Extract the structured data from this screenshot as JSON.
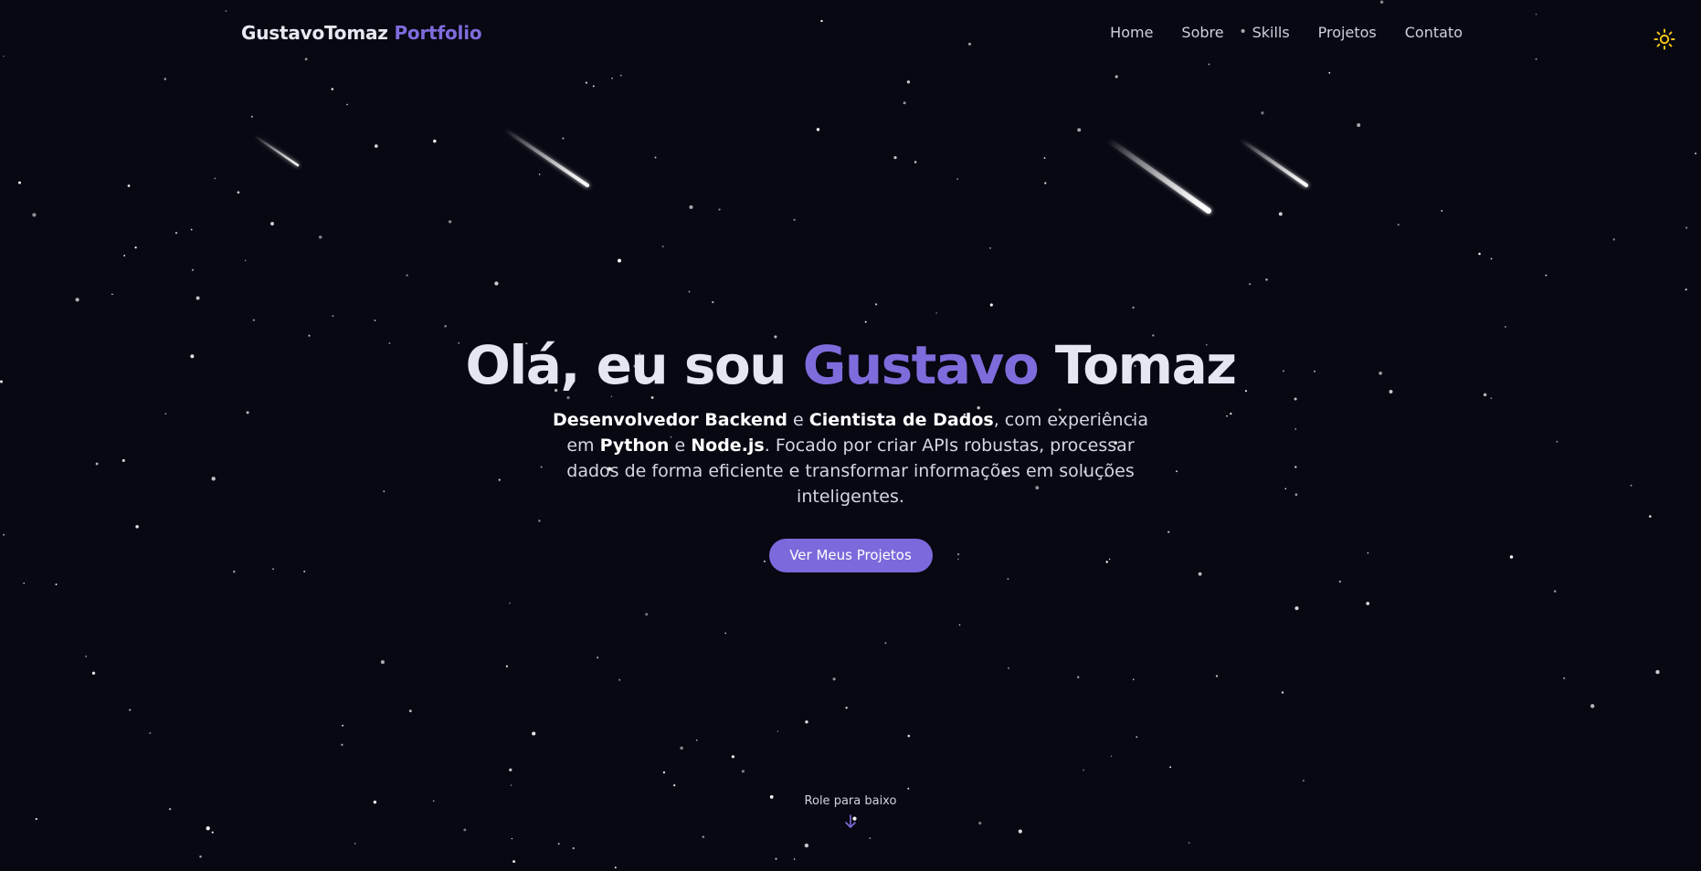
{
  "brand": {
    "name": "GustavoTomaz",
    "suffix": "Portfolio"
  },
  "nav": {
    "items": [
      {
        "label": "Home"
      },
      {
        "label": "Sobre"
      },
      {
        "label": "Skills"
      },
      {
        "label": "Projetos"
      },
      {
        "label": "Contato"
      }
    ]
  },
  "theme_toggle": {
    "icon": "sun-icon",
    "color": "#f5c518"
  },
  "hero": {
    "greeting": "Olá, eu sou",
    "first_name": "Gustavo",
    "last_name": "Tomaz",
    "description": {
      "role1": "Desenvolvedor Backend",
      "connector1": " e ",
      "role2": "Cientista de Dados",
      "text1": ", com experiência em ",
      "tech1": "Python",
      "connector2": " e ",
      "tech2": "Node.js",
      "text2": ". Focado por criar APIs robustas, processar dados de forma eficiente e transformar informações em soluções inteligentes."
    },
    "cta_label": "Ver Meus Projetos"
  },
  "scroll_hint": {
    "label": "Role para baixo",
    "icon": "arrow-down-icon"
  },
  "colors": {
    "background": "#070812",
    "accent": "#7f6cdc",
    "text": "#e4e6f1",
    "sun": "#f5c518"
  }
}
